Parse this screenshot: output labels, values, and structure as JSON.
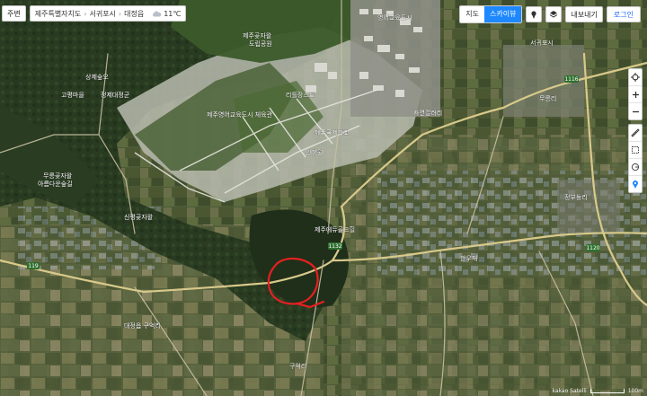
{
  "toolbar": {
    "home_label": "주변",
    "breadcrumb": [
      "제주특별자치도",
      "서귀포시",
      "대정읍"
    ],
    "weather_temp": "11℃",
    "map_view_label": "지도",
    "sky_view_label": "스카이뷰",
    "export_label": "내보내기",
    "login_label": "로그인"
  },
  "map": {
    "labels": {
      "park": "제주곶자왈\n도립공원",
      "r1": "고평마을",
      "r2": "상제숲오",
      "r3": "정제대정군",
      "r4": "무릉곶자왈\n아름다운숲길",
      "r5": "제주영어교육도시 체육관",
      "r6": "제주국제학교",
      "r7": "리틀장스트",
      "r8": "자연갤러리",
      "r9": "인향원",
      "r10": "제주에듀골드힐",
      "r11": "한우재",
      "r12": "정부능리",
      "r13": "신평곶자왈",
      "r14": "대정읍 구억리",
      "r15": "구억리",
      "r16": "영어교육도시",
      "r17": "무릉리",
      "r18": "서귀포시"
    },
    "road_numbers": [
      "119",
      "1132",
      "1116",
      "1120"
    ]
  },
  "attribution": {
    "text": "kakao  Satelli",
    "scale": "100m"
  },
  "colors": {
    "accent": "#1e88ff",
    "annotation_circle": "#e52020"
  }
}
